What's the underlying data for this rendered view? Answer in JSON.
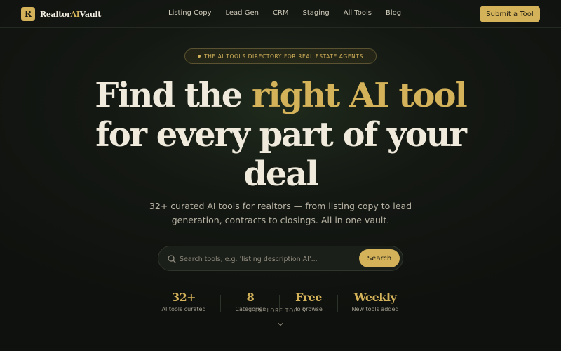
{
  "nav": {
    "logo_badge": "R",
    "logo_pre": "Realtor",
    "logo_ai": "AI",
    "logo_post": "Vault",
    "items": [
      "Listing Copy",
      "Lead Gen",
      "CRM",
      "Staging",
      "All Tools",
      "Blog"
    ],
    "submit_label": "Submit a Tool"
  },
  "hero": {
    "eyebrow": "THE AI TOOLS DIRECTORY FOR REAL ESTATE AGENTS",
    "headline_1": "Find the ",
    "headline_gold": "right AI tool",
    "headline_2": "for every part of your",
    "headline_3": "deal",
    "subtitle": "32+ curated AI tools for realtors — from listing copy to lead generation, contracts to closings. All in one vault."
  },
  "search": {
    "placeholder": "Search tools, e.g. 'listing description AI'...",
    "value": "",
    "button_label": "Search"
  },
  "stats": [
    {
      "value": "32+",
      "label": "AI tools curated"
    },
    {
      "value": "8",
      "label": "Categories"
    },
    {
      "value": "Free",
      "label": "To browse"
    },
    {
      "value": "Weekly",
      "label": "New tools added"
    }
  ],
  "explore_label": "EXPLORE TOOLS",
  "colors": {
    "accent": "#d4b25a",
    "background": "#141813"
  },
  "icons": {
    "search": "search-icon",
    "scroll": "chevron-down-icon"
  }
}
